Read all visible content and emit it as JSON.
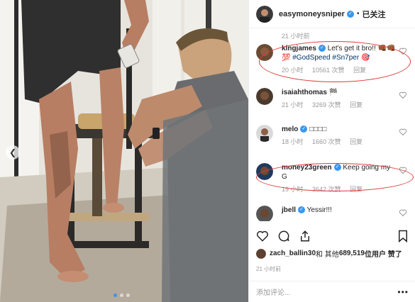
{
  "post": {
    "author": "easymoneysniper",
    "follow_label": "已关注",
    "header_sep": "•",
    "first_comment_time": "21 小时前"
  },
  "comments": [
    {
      "user": "kingjames",
      "text_pre": "Let's get it bro!! ",
      "emoji": "👊🏾👊🏾💯",
      "hashtags": "#GodSpeed #Sn7per",
      "text_post": " 🎯",
      "time": "20 小时",
      "likes": "10561 次赞",
      "reply": "回复"
    },
    {
      "user": "isaiahthomas",
      "text": "🏁",
      "time": "21 小时",
      "likes": "3269 次赞",
      "reply": "回复"
    },
    {
      "user": "melo",
      "text": "□□□□",
      "time": "18 小时",
      "likes": "1660 次赞",
      "reply": "回复"
    },
    {
      "user": "money23green",
      "text": "Keep going my G",
      "time": "19 小时",
      "likes": "3642 次赞",
      "reply": "回复"
    },
    {
      "user": "jbell",
      "text": "Yessir!!!"
    }
  ],
  "likes_line": {
    "user": "zach_ballin30",
    "middle": " 和 其他 ",
    "count": "689,519",
    "suffix": " 位用户 赞了"
  },
  "post_time": "21 小时前",
  "add_comment_placeholder": "添加评论...",
  "more_glyph": "•••",
  "colors": {
    "verified": "#3897f0",
    "highlight_ring": "#e03a3a",
    "hashtag": "#003569"
  },
  "icons": [
    "heart-icon",
    "comment-icon",
    "share-icon",
    "bookmark-icon",
    "verified-badge-icon",
    "chevron-left-icon"
  ]
}
